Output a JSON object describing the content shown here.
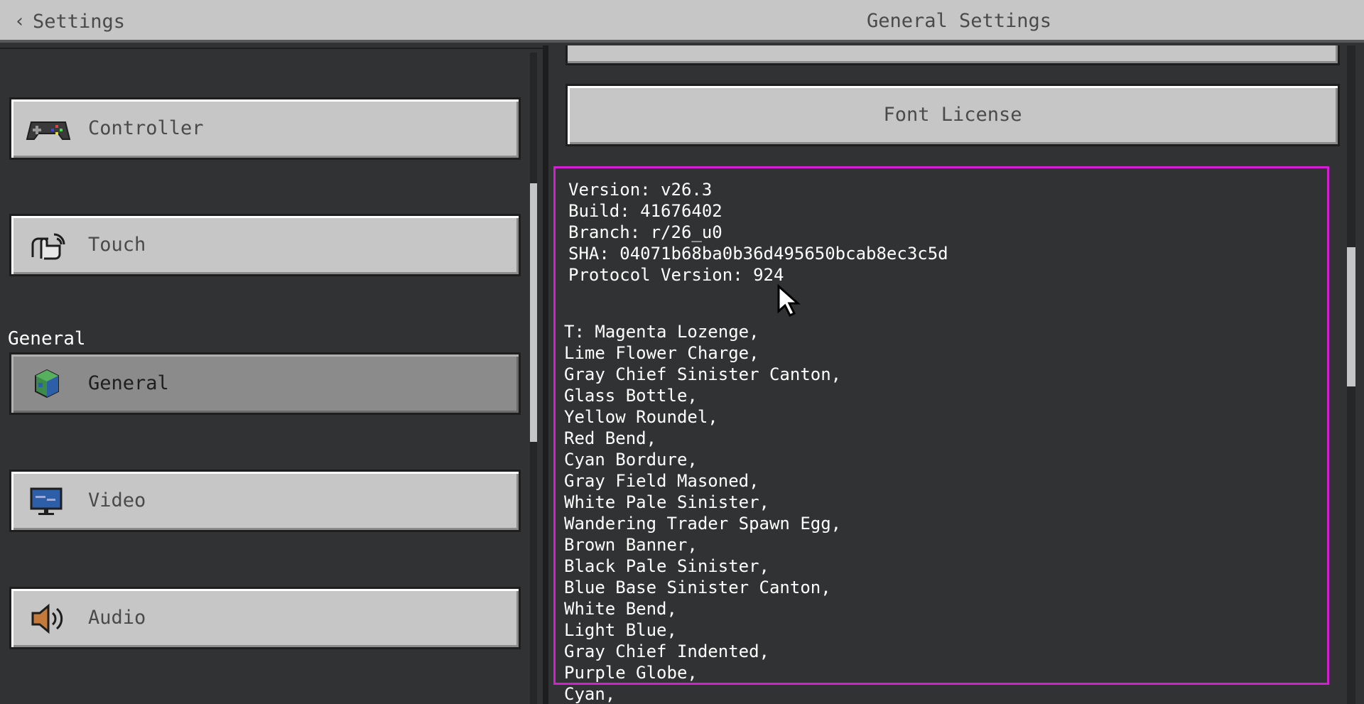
{
  "header": {
    "back_label": "Settings",
    "title": "General Settings"
  },
  "sidebar": {
    "items": [
      {
        "label": "Controller",
        "icon": "controller-icon",
        "selected": false
      },
      {
        "label": "Touch",
        "icon": "touch-icon",
        "selected": false
      },
      {
        "label": "General",
        "icon": "globe-icon",
        "selected": true
      },
      {
        "label": "Video",
        "icon": "monitor-icon",
        "selected": false
      },
      {
        "label": "Audio",
        "icon": "speaker-icon",
        "selected": false
      }
    ],
    "section_label": "General"
  },
  "main": {
    "font_license_label": "Font License",
    "info": {
      "version": "Version: v26.3",
      "build": "Build: 41676402",
      "branch": "Branch: r/26_u0",
      "sha": "SHA: 04071b68ba0b36d495650bcab8ec3c5d",
      "protocol": "Protocol Version: 924"
    },
    "items": [
      "T: Magenta Lozenge,",
      "Lime Flower Charge,",
      "Gray Chief Sinister Canton,",
      "Glass Bottle,",
      "Yellow Roundel,",
      "Red Bend,",
      "Cyan Bordure,",
      "Gray Field Masoned,",
      "White Pale Sinister,",
      "Wandering Trader Spawn Egg,",
      "Brown Banner,",
      "Black Pale Sinister,",
      "Blue Base Sinister Canton,",
      "White Bend,",
      "Light Blue,",
      "Gray Chief Indented,",
      "Purple Globe,",
      "Cyan,"
    ]
  },
  "colors": {
    "panel_dark": "#313233",
    "button_gray": "#c6c6c6",
    "highlight_magenta": "#d21fd2"
  }
}
